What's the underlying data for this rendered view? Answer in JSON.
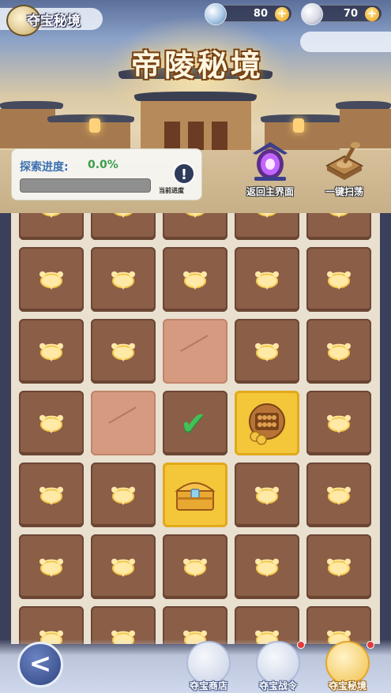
{
  "header": {
    "page_title": "夺宝秘境",
    "big_title": "帝陵秘境"
  },
  "resources": [
    {
      "icon": "pearl-currency-icon",
      "value": "80",
      "add_label": "+"
    },
    {
      "icon": "silver-currency-icon",
      "value": "70",
      "add_label": "+"
    }
  ],
  "progress": {
    "label": "探索进度:",
    "value": "0.0%",
    "fraction": 0.0,
    "info_label": "当前进度",
    "info_glyph": "!"
  },
  "actions": [
    {
      "label": "返回主界面",
      "icon": "portal-icon"
    },
    {
      "label": "一键扫荡",
      "icon": "sweep-icon"
    }
  ],
  "board": {
    "columns": 5,
    "rows": [
      [
        "locked",
        "locked",
        "locked",
        "locked",
        "locked"
      ],
      [
        "locked",
        "locked",
        "locked",
        "locked",
        "locked"
      ],
      [
        "locked",
        "locked",
        "dug",
        "locked",
        "locked"
      ],
      [
        "locked",
        "dug",
        "cleared",
        "abacus-reward",
        "locked"
      ],
      [
        "locked",
        "locked",
        "treasure-chest",
        "locked",
        "locked"
      ],
      [
        "locked",
        "locked",
        "locked",
        "locked",
        "locked"
      ],
      [
        "locked",
        "locked",
        "locked",
        "locked",
        "locked"
      ]
    ]
  },
  "bottom_nav": {
    "back_glyph": "<",
    "items": [
      {
        "label": "夺宝商店",
        "icon": "shop-icon",
        "badge": false,
        "active": false
      },
      {
        "label": "夺宝战令",
        "icon": "battle-pass-icon",
        "badge": true,
        "active": false
      },
      {
        "label": "夺宝秘境",
        "icon": "realm-icon",
        "badge": true,
        "active": true
      }
    ]
  },
  "colors": {
    "tile": "#8a5e47",
    "tile_dug": "#d59a80",
    "tile_reward": "#f4c63a",
    "progress_label": "#3a6fb0",
    "progress_value": "#3b9e4b",
    "check": "#43c058"
  }
}
